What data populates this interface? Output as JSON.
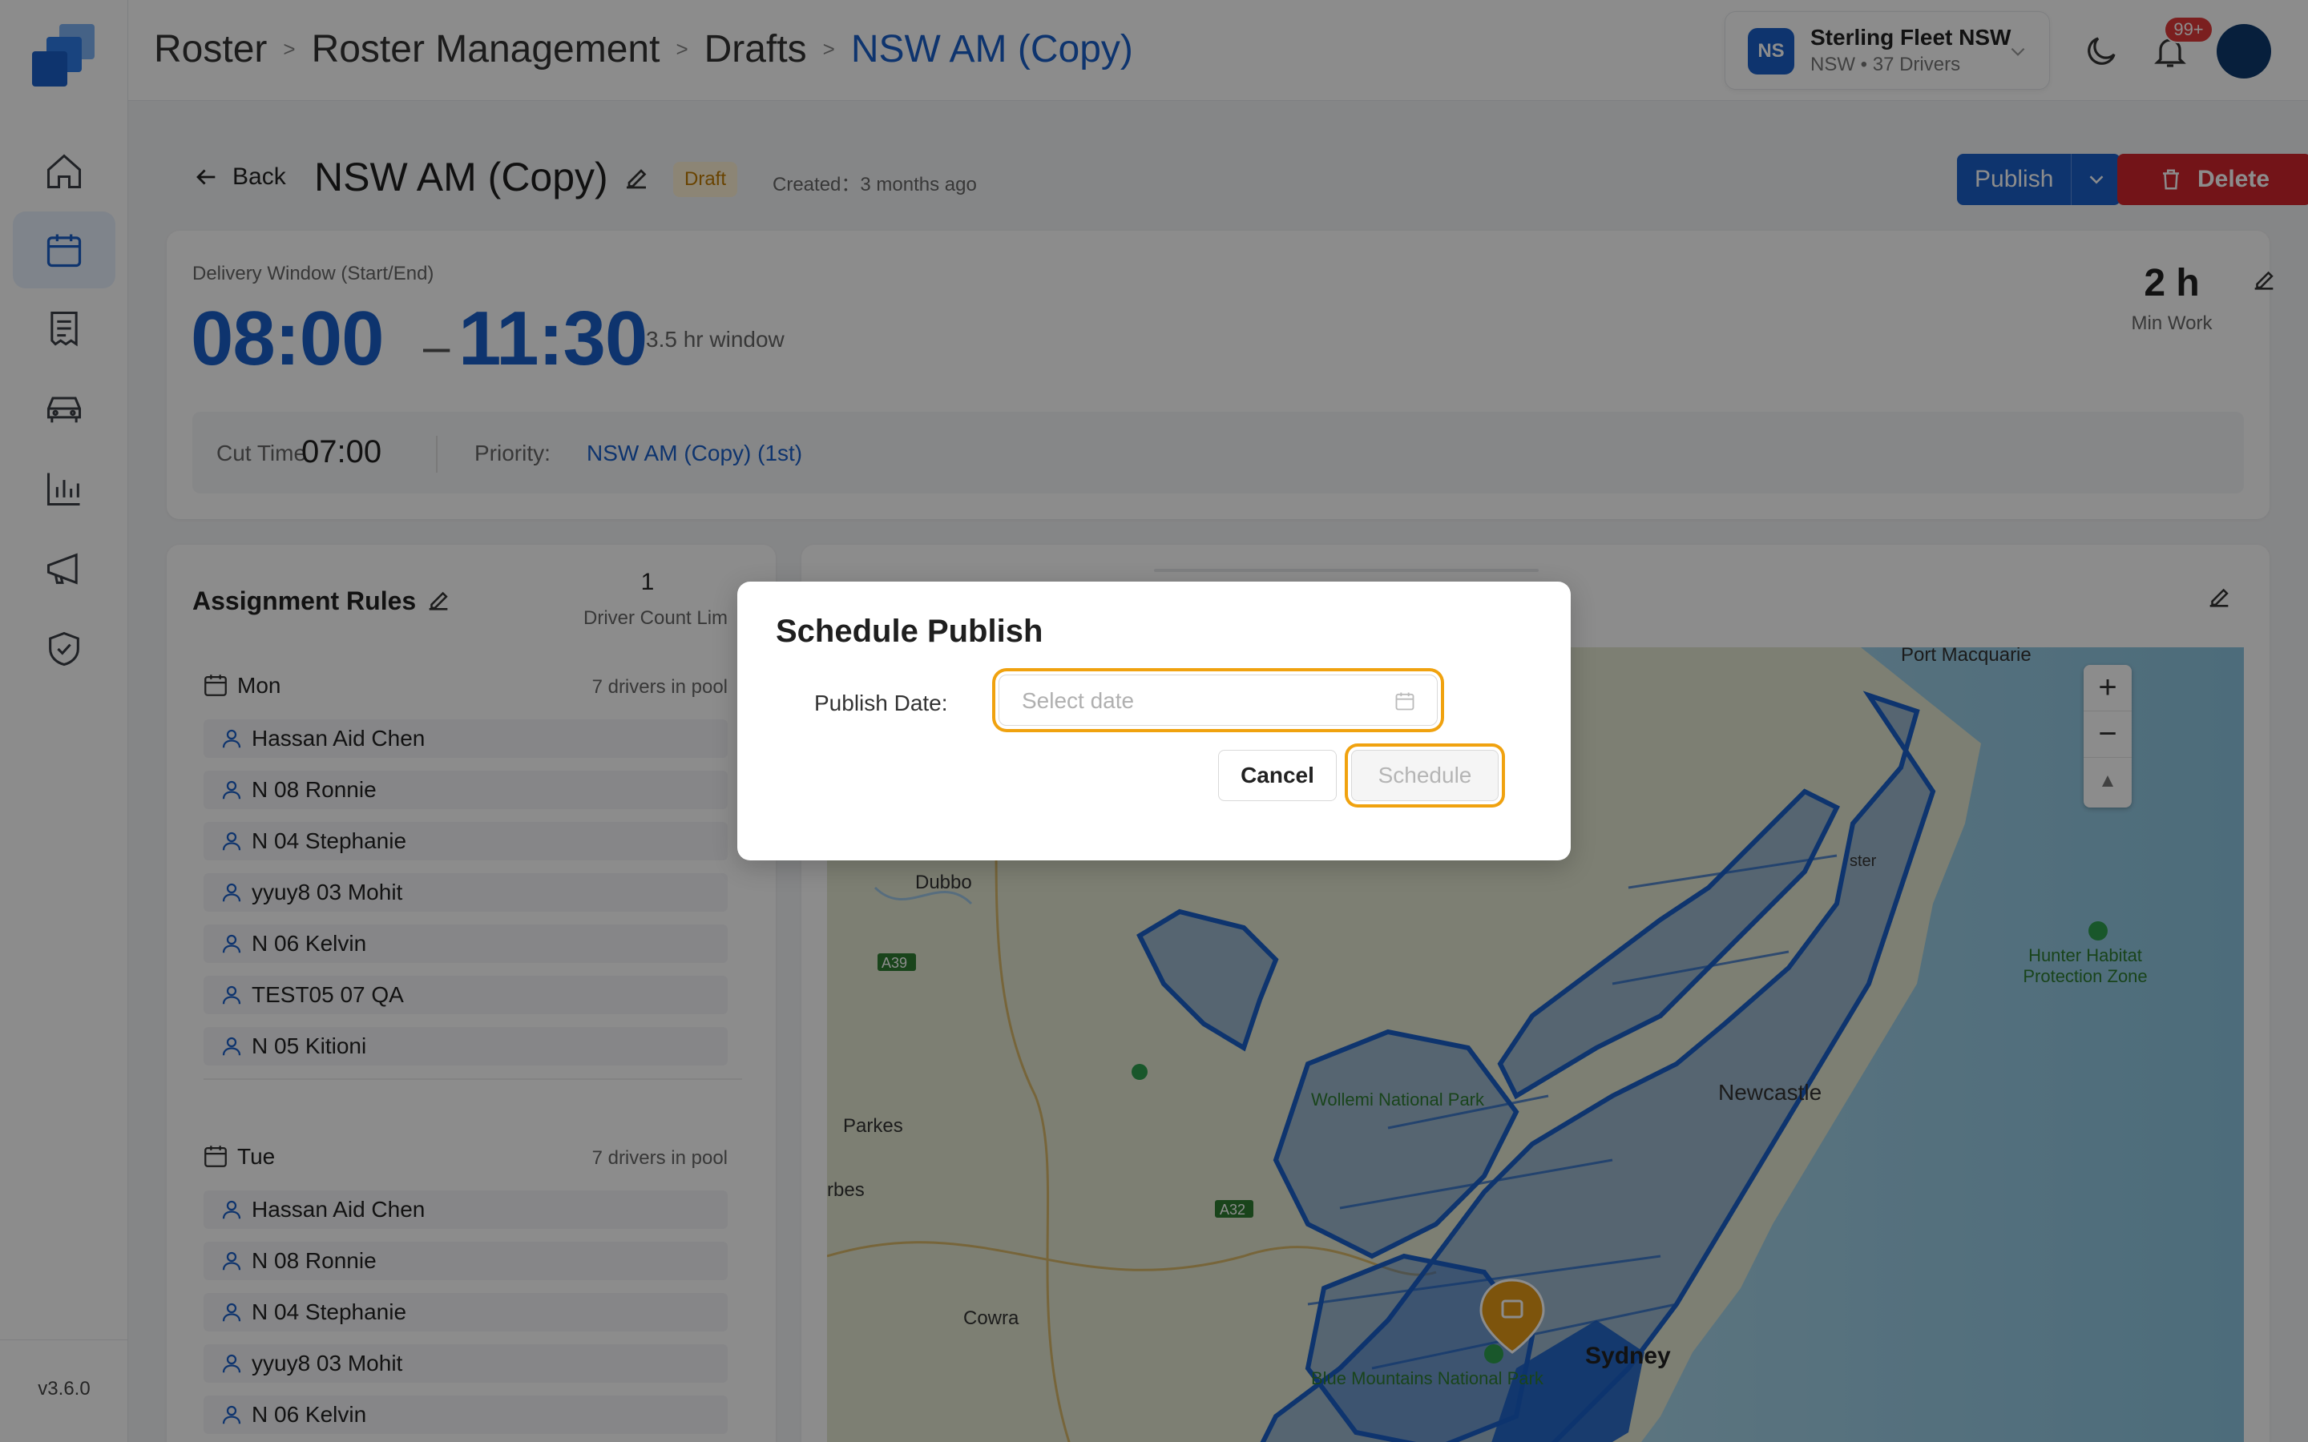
{
  "app": {
    "version": "v3.6.0",
    "sidebar_items": [
      {
        "name": "home",
        "icon": "home-icon"
      },
      {
        "name": "roster",
        "icon": "calendar-icon",
        "active": true
      },
      {
        "name": "documents",
        "icon": "document-icon"
      },
      {
        "name": "vehicles",
        "icon": "car-icon"
      },
      {
        "name": "reports",
        "icon": "bar-chart-icon"
      },
      {
        "name": "announcements",
        "icon": "megaphone-icon"
      },
      {
        "name": "compliance",
        "icon": "shield-check-icon"
      }
    ],
    "colors": {
      "accent": "#1a5fc8",
      "danger": "#d1262d",
      "draft": "#c07a00",
      "highlight": "#f0a20f"
    }
  },
  "breadcrumb": {
    "items": [
      "Roster",
      "Roster Management",
      "Drafts"
    ],
    "current": "NSW AM (Copy)",
    "separator": ">"
  },
  "org": {
    "initials": "NS",
    "name": "Sterling Fleet NSW",
    "subtitle": "NSW • 37 Drivers"
  },
  "notifications": {
    "count": "99+"
  },
  "header": {
    "back_label": "Back",
    "title": "NSW AM (Copy)",
    "status": "Draft",
    "created": "Created：3 months ago",
    "publish_label": "Publish",
    "delete_label": "Delete"
  },
  "delivery": {
    "label": "Delivery Window (Start/End)",
    "start": "08:00",
    "dash": "–",
    "end": "11:30",
    "window": "3.5 hr window",
    "min_work_value": "2 h",
    "min_work_label": "Min Work",
    "cut_label": "Cut Time",
    "cut_value": "07:00",
    "priority_label": "Priority:",
    "priority_value": "NSW AM (Copy) (1st)"
  },
  "rules": {
    "title": "Assignment Rules",
    "driver_count_value": "1",
    "driver_count_label": "Driver Count Lim",
    "days": [
      {
        "name": "Mon",
        "pool": "7 drivers in pool",
        "drivers": [
          "Hassan Aid Chen",
          "N 08 Ronnie",
          "N 04 Stephanie",
          "yyuy8 03 Mohit",
          "N 06 Kelvin",
          "TEST05 07 QA",
          "N 05 Kitioni"
        ]
      },
      {
        "name": "Tue",
        "pool": "7 drivers in pool",
        "drivers": [
          "Hassan Aid Chen",
          "N 08 Ronnie",
          "N 04 Stephanie",
          "yyuy8 03 Mohit",
          "N 06 Kelvin"
        ]
      }
    ]
  },
  "map": {
    "labels": {
      "port_macquarie": "Port Macquarie",
      "dubbo": "Dubbo",
      "a39": "A39",
      "parkes": "Parkes",
      "forbes": "rbes",
      "a32": "A32",
      "cowra": "Cowra",
      "wollemi": "Wollemi National Park",
      "newcastle": "Newcastle",
      "hunter": "Hunter Habitat Protection Zone",
      "blue_mountains": "Blue Mountains National Park",
      "sydney": "Sydney",
      "ster": "ster"
    },
    "zoom_in": "+",
    "zoom_out": "−",
    "compass": "▲"
  },
  "modal": {
    "title": "Schedule Publish",
    "date_label": "Publish Date",
    "date_placeholder": "Select date",
    "cancel_label": "Cancel",
    "schedule_label": "Schedule"
  }
}
